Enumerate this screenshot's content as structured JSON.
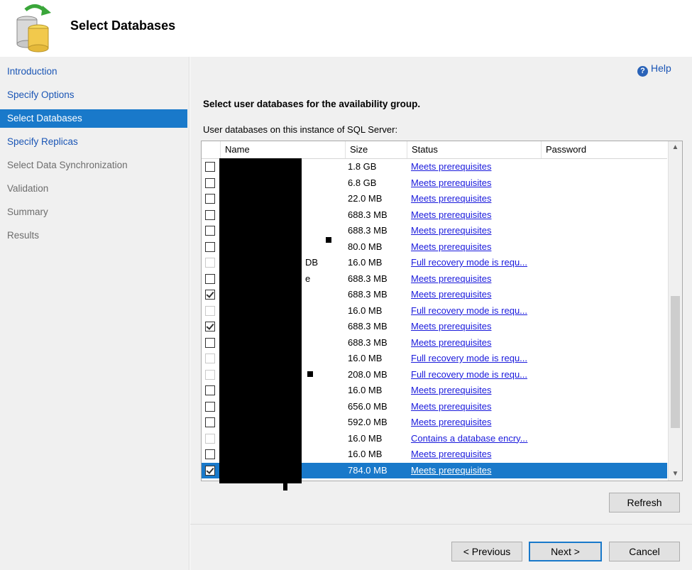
{
  "header": {
    "title": "Select Databases",
    "icon": "database-icon"
  },
  "sidebar": {
    "items": [
      {
        "label": "Introduction",
        "state": "link"
      },
      {
        "label": "Specify Options",
        "state": "link"
      },
      {
        "label": "Select Databases",
        "state": "active"
      },
      {
        "label": "Specify Replicas",
        "state": "link"
      },
      {
        "label": "Select Data Synchronization",
        "state": "disabled"
      },
      {
        "label": "Validation",
        "state": "disabled"
      },
      {
        "label": "Summary",
        "state": "disabled"
      },
      {
        "label": "Results",
        "state": "disabled"
      }
    ]
  },
  "help": {
    "label": "Help"
  },
  "main": {
    "heading": "Select user databases for the availability group.",
    "subheading": "User databases on this instance of SQL Server:"
  },
  "grid": {
    "columns": [
      "Name",
      "Size",
      "Status",
      "Password"
    ],
    "rows": [
      {
        "name": "",
        "size": "1.8 GB",
        "status": "Meets prerequisites",
        "checked": false,
        "enabled": true
      },
      {
        "name": "",
        "size": "6.8 GB",
        "status": "Meets prerequisites",
        "checked": false,
        "enabled": true
      },
      {
        "name": "",
        "size": "22.0 MB",
        "status": "Meets prerequisites",
        "checked": false,
        "enabled": true
      },
      {
        "name": "",
        "size": "688.3 MB",
        "status": "Meets prerequisites",
        "checked": false,
        "enabled": true
      },
      {
        "name": "",
        "size": "688.3 MB",
        "status": "Meets prerequisites",
        "checked": false,
        "enabled": true
      },
      {
        "name": "",
        "size": "80.0 MB",
        "status": "Meets prerequisites",
        "checked": false,
        "enabled": true
      },
      {
        "name": "DB",
        "size": "16.0 MB",
        "status": "Full recovery mode is requ...",
        "checked": false,
        "enabled": false
      },
      {
        "name": "e",
        "size": "688.3 MB",
        "status": "Meets prerequisites",
        "checked": false,
        "enabled": true
      },
      {
        "name": "",
        "size": "688.3 MB",
        "status": "Meets prerequisites",
        "checked": true,
        "enabled": true
      },
      {
        "name": "",
        "size": "16.0 MB",
        "status": "Full recovery mode is requ...",
        "checked": false,
        "enabled": false
      },
      {
        "name": "",
        "size": "688.3 MB",
        "status": "Meets prerequisites",
        "checked": true,
        "enabled": true
      },
      {
        "name": "",
        "size": "688.3 MB",
        "status": "Meets prerequisites",
        "checked": false,
        "enabled": true
      },
      {
        "name": "",
        "size": "16.0 MB",
        "status": "Full recovery mode is requ...",
        "checked": false,
        "enabled": false
      },
      {
        "name": "",
        "size": "208.0 MB",
        "status": "Full recovery mode is requ...",
        "checked": false,
        "enabled": false
      },
      {
        "name": "",
        "size": "16.0 MB",
        "status": "Meets prerequisites",
        "checked": false,
        "enabled": true
      },
      {
        "name": "",
        "size": "656.0 MB",
        "status": "Meets prerequisites",
        "checked": false,
        "enabled": true
      },
      {
        "name": "",
        "size": "592.0 MB",
        "status": "Meets prerequisites",
        "checked": false,
        "enabled": true
      },
      {
        "name": "",
        "size": "16.0 MB",
        "status": "Contains a database encry...",
        "checked": false,
        "enabled": false
      },
      {
        "name": "",
        "size": "16.0 MB",
        "status": "Meets prerequisites",
        "checked": false,
        "enabled": true
      },
      {
        "name": "",
        "size": "784.0 MB",
        "status": "Meets prerequisites",
        "checked": true,
        "enabled": true,
        "selected": true
      }
    ]
  },
  "buttons": {
    "refresh": "Refresh",
    "previous": "< Previous",
    "next": "Next >",
    "cancel": "Cancel"
  },
  "colors": {
    "accent": "#1979ca",
    "link": "#1a55b5",
    "status_link": "#1a1adc"
  }
}
